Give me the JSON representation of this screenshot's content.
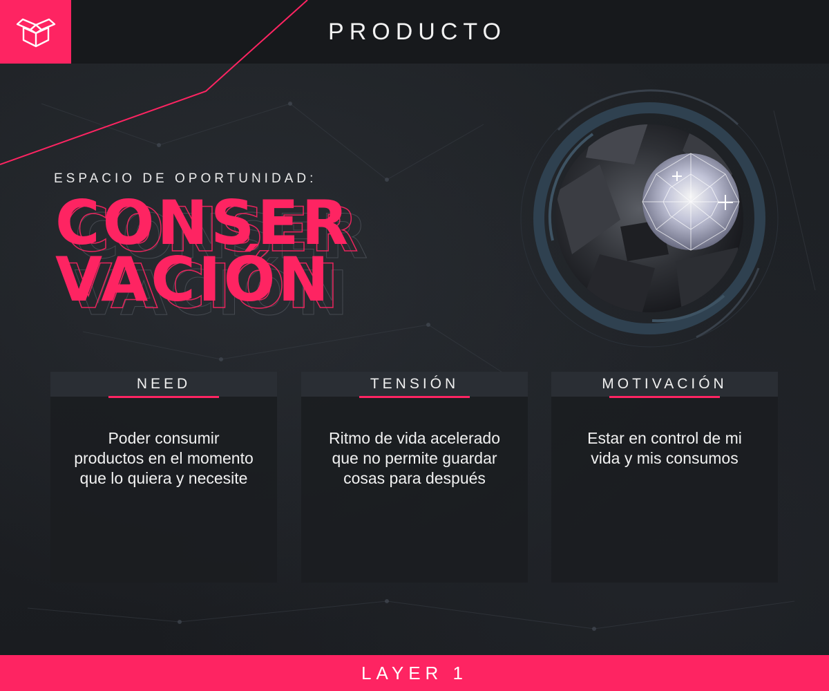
{
  "header": {
    "title": "PRODUCTO",
    "logo_icon": "box-icon"
  },
  "opportunity": {
    "label": "ESPACIO DE OPORTUNIDAD:",
    "word_line1": "CONSER",
    "word_line2": "VACIÓN"
  },
  "image": {
    "subject": "diamond-on-coal-image"
  },
  "cards": [
    {
      "title": "NEED",
      "body": "Poder consumir productos en el momento que lo quiera y necesite"
    },
    {
      "title": "TENSIÓN",
      "body": "Ritmo de vida acelerado que no permite guardar cosas para después"
    },
    {
      "title": "MOTIVACIÓN",
      "body": "Estar en control de mi vida y mis consumos"
    }
  ],
  "footer": {
    "label": "LAYER 1"
  },
  "colors": {
    "accent": "#fe2462",
    "background": "#1c1e22",
    "header_bg": "#17191c",
    "card_head_bg": "#2a2e34"
  }
}
